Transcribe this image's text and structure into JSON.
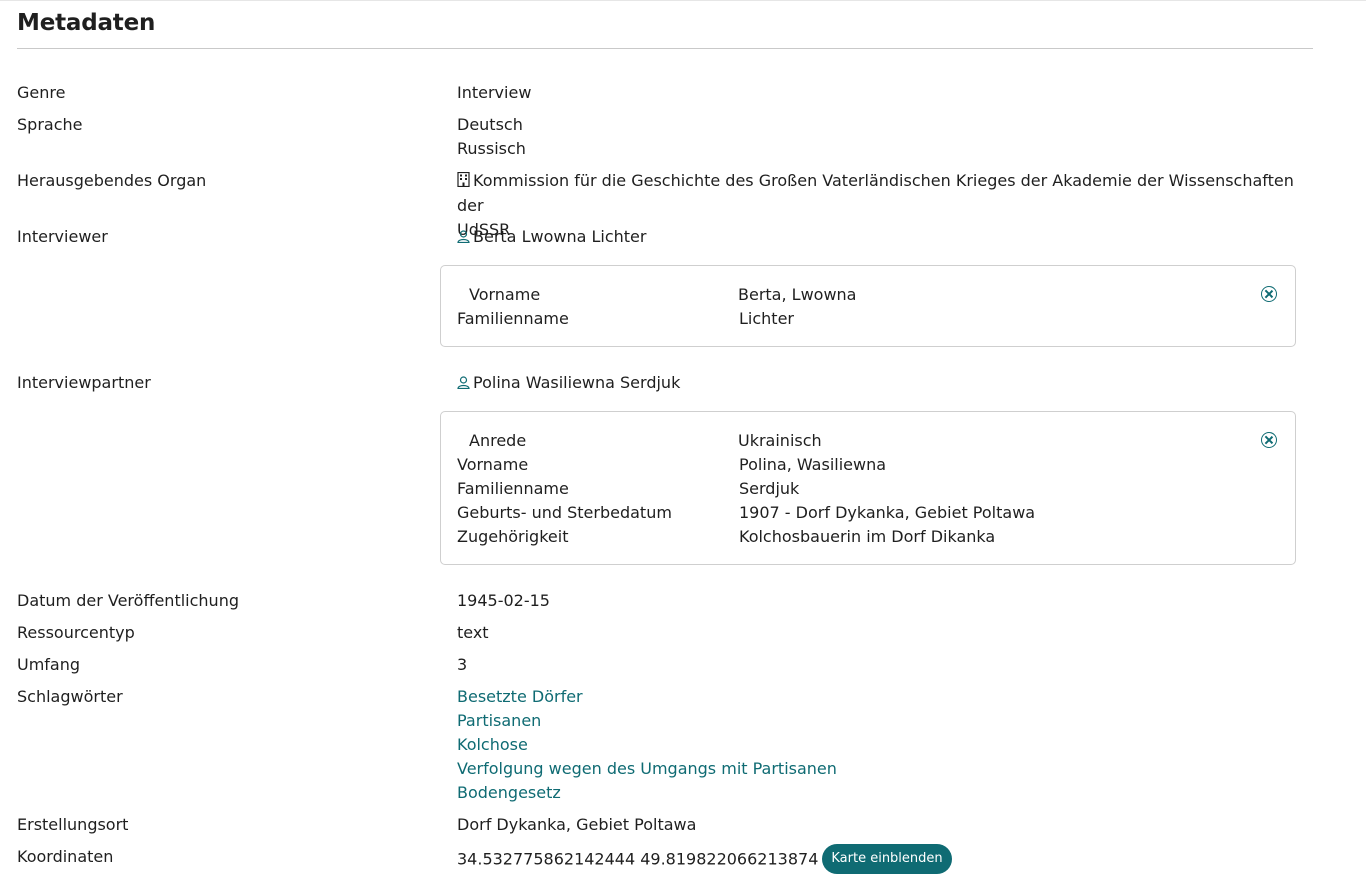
{
  "title": "Metadaten",
  "genre": {
    "label": "Genre",
    "value": "Interview"
  },
  "sprache": {
    "label": "Sprache",
    "values": [
      "Deutsch",
      "Russisch"
    ]
  },
  "herausgeber": {
    "label": "Herausgebendes Organ",
    "line1": "Kommission für die Geschichte des Großen Vaterländischen Krieges der Akademie der Wissenschaften der",
    "line2": "UdSSR",
    "icon": "building-icon"
  },
  "interviewer": {
    "label": "Interviewer",
    "name": "Berta Lwowna Lichter",
    "icon": "person-icon",
    "details": [
      {
        "key": "Vorname",
        "value": "Berta, Lwowna"
      },
      {
        "key": "Familienname",
        "value": "Lichter"
      }
    ]
  },
  "interviewpartner": {
    "label": "Interviewpartner",
    "name": "Polina Wasiliewna Serdjuk",
    "icon": "person-icon",
    "details": [
      {
        "key": "Anrede",
        "value": "Ukrainisch"
      },
      {
        "key": "Vorname",
        "value": "Polina, Wasiliewna"
      },
      {
        "key": "Familienname",
        "value": "Serdjuk"
      },
      {
        "key": "Geburts- und Sterbedatum",
        "value": "1907 - Dorf Dykanka, Gebiet Poltawa"
      },
      {
        "key": "Zugehörigkeit",
        "value": "Kolchosbauerin im Dorf Dikanka"
      }
    ]
  },
  "datum": {
    "label": "Datum der Veröffentlichung",
    "value": "1945-02-15"
  },
  "ressourcentyp": {
    "label": "Ressourcentyp",
    "value": "text"
  },
  "umfang": {
    "label": "Umfang",
    "value": "3"
  },
  "schlagwoerter": {
    "label": "Schlagwörter",
    "items": [
      "Besetzte Dörfer",
      "Partisanen",
      "Kolchose",
      "Verfolgung wegen des Umgangs mit Partisanen",
      "Bodengesetz"
    ]
  },
  "erstellungsort": {
    "label": "Erstellungsort",
    "value": "Dorf Dykanka, Gebiet Poltawa"
  },
  "koordinaten": {
    "label": "Koordinaten",
    "value": "34.532775862142444 49.819822066213874",
    "button": "Karte einblenden"
  },
  "colors": {
    "accent": "#0f6b73",
    "text": "#1f1f1f",
    "border": "#cfcfcf"
  }
}
